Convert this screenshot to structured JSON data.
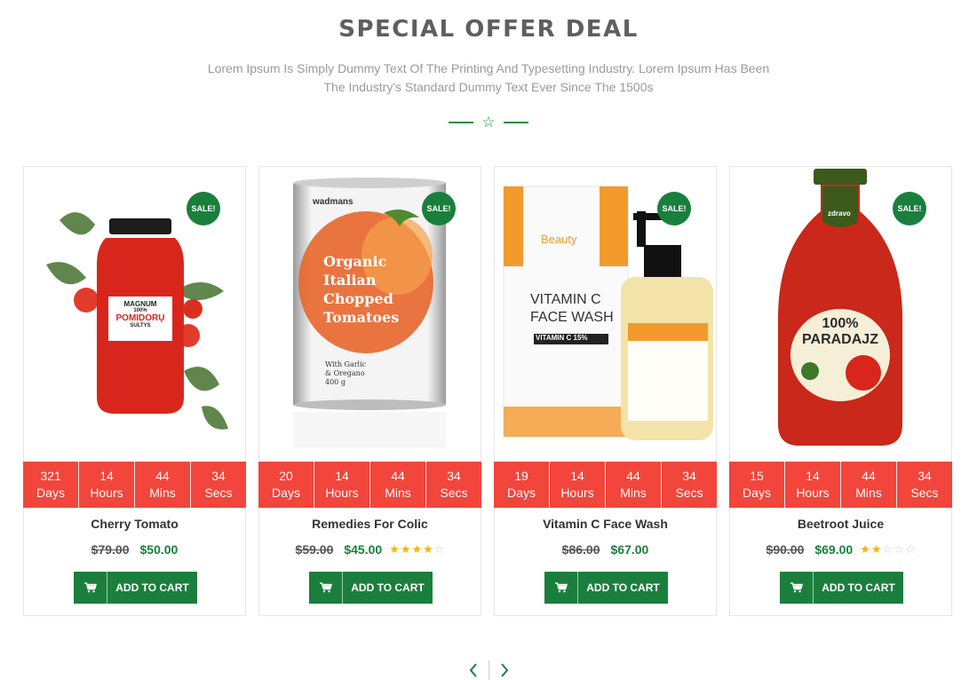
{
  "section": {
    "title": "SPECIAL OFFER DEAL",
    "description": "Lorem Ipsum Is Simply Dummy Text Of The Printing And Typesetting Industry. Lorem Ipsum Has Been The Industry's Standard Dummy Text Ever Since The 1500s",
    "divider_icon": "star-outline-icon"
  },
  "colors": {
    "accent_green": "#1a7f3c",
    "countdown_red": "#f2453b",
    "star_gold": "#f5b50a"
  },
  "products": [
    {
      "name": "Cherry Tomato",
      "badge": "SALE!",
      "old_price": "$79.00",
      "new_price": "$50.00",
      "rating": 0,
      "countdown": [
        {
          "value": "321",
          "unit": "Days"
        },
        {
          "value": "14",
          "unit": "Hours"
        },
        {
          "value": "44",
          "unit": "Mins"
        },
        {
          "value": "34",
          "unit": "Secs"
        }
      ],
      "image_text": {
        "brand": "MAGNUM",
        "line1": "100%",
        "line2": "POMIDORŲ",
        "line3": "SULTYS"
      },
      "cart_label": "ADD TO CART"
    },
    {
      "name": "Remedies For Colic",
      "badge": "SALE!",
      "old_price": "$59.00",
      "new_price": "$45.00",
      "rating": 4,
      "countdown": [
        {
          "value": "20",
          "unit": "Days"
        },
        {
          "value": "14",
          "unit": "Hours"
        },
        {
          "value": "44",
          "unit": "Mins"
        },
        {
          "value": "34",
          "unit": "Secs"
        }
      ],
      "image_text": {
        "brand": "wadmans",
        "line1": "Organic",
        "line2": "Italian",
        "line3": "Chopped",
        "line4": "Tomatoes",
        "line5": "With Garlic",
        "line6": "& Oregano",
        "line7": "400 g"
      },
      "cart_label": "ADD TO CART"
    },
    {
      "name": "Vitamin C Face Wash",
      "badge": "SALE!",
      "old_price": "$86.00",
      "new_price": "$67.00",
      "rating": 0,
      "countdown": [
        {
          "value": "19",
          "unit": "Days"
        },
        {
          "value": "14",
          "unit": "Hours"
        },
        {
          "value": "44",
          "unit": "Mins"
        },
        {
          "value": "34",
          "unit": "Secs"
        }
      ],
      "image_text": {
        "brand": "Beauty",
        "line1": "VITAMIN C",
        "line2": "FACE WASH",
        "line3": "VITAMIN C 15%"
      },
      "cart_label": "ADD TO CART"
    },
    {
      "name": "Beetroot Juice",
      "badge": "SALE!",
      "old_price": "$90.00",
      "new_price": "$69.00",
      "rating": 2,
      "countdown": [
        {
          "value": "15",
          "unit": "Days"
        },
        {
          "value": "14",
          "unit": "Hours"
        },
        {
          "value": "44",
          "unit": "Mins"
        },
        {
          "value": "34",
          "unit": "Secs"
        }
      ],
      "image_text": {
        "brand": "zdravo",
        "line1": "100%",
        "line2": "PARADAJZ"
      },
      "cart_label": "ADD TO CART"
    }
  ],
  "pager": {
    "prev_icon": "chevron-left-icon",
    "next_icon": "chevron-right-icon"
  }
}
